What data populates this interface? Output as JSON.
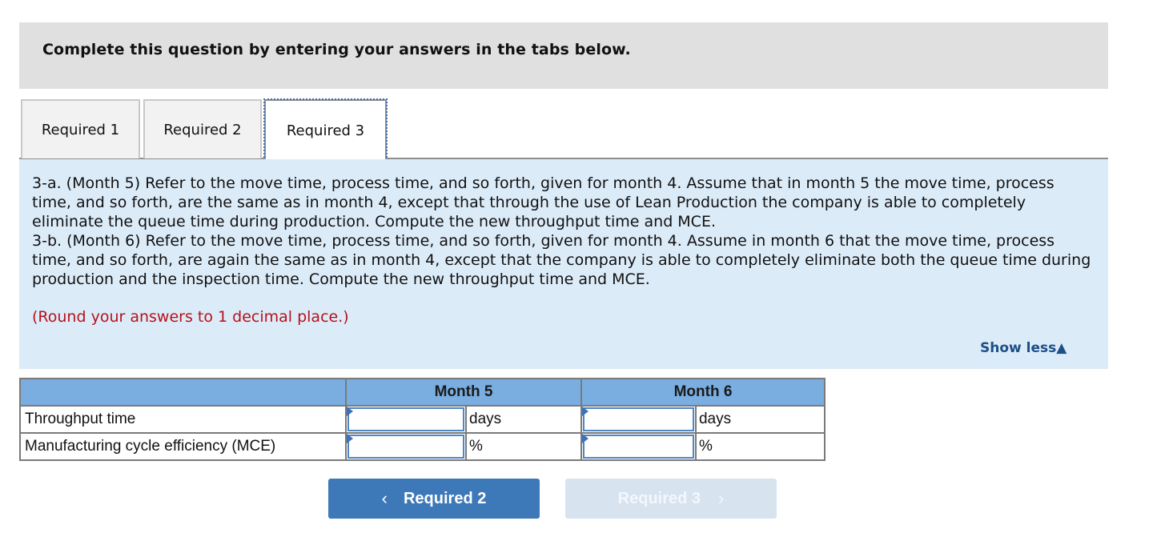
{
  "header": {
    "title": "Complete this question by entering your answers in the tabs below."
  },
  "tabs": [
    {
      "label": "Required 1",
      "active": false
    },
    {
      "label": "Required 2",
      "active": false
    },
    {
      "label": "Required 3",
      "active": true
    }
  ],
  "content": {
    "paragraph_3a": "3-a. (Month 5) Refer to the move time, process time, and so forth, given for month 4. Assume that in month 5 the move time, process time, and so forth, are the same as in month 4, except that through the use of Lean Production the company is able to completely eliminate the queue time during production.  Compute the new throughput time and MCE.",
    "paragraph_3b": "3-b. (Month 6) Refer to the move time, process time, and so forth, given for month 4. Assume in month 6 that the move time, process time, and so forth, are again the same as in month 4, except that the company is able to completely eliminate both the queue time during production and the inspection time. Compute the new throughput time and MCE.",
    "rounding_note": "(Round your answers to 1 decimal place.)",
    "show_less_label": "Show less",
    "show_less_icon": "▲"
  },
  "table": {
    "headers": [
      "",
      "Month 5",
      "Month 6"
    ],
    "rows": [
      {
        "label": "Throughput time",
        "month5_value": "",
        "month5_unit": "days",
        "month6_value": "",
        "month6_unit": "days"
      },
      {
        "label": "Manufacturing cycle efficiency (MCE)",
        "month5_value": "",
        "month5_unit": "%",
        "month6_value": "",
        "month6_unit": "%"
      }
    ]
  },
  "nav": {
    "prev_label": "Required 2",
    "prev_icon": "‹",
    "next_label": "Required 3",
    "next_icon": "›"
  },
  "colors": {
    "header_bg": "#e0e0e0",
    "content_bg": "#dcebf8",
    "table_header_bg": "#7aade0",
    "note_red": "#b5121b",
    "primary_button": "#3d78b8",
    "disabled_button": "#d8e3f0"
  }
}
